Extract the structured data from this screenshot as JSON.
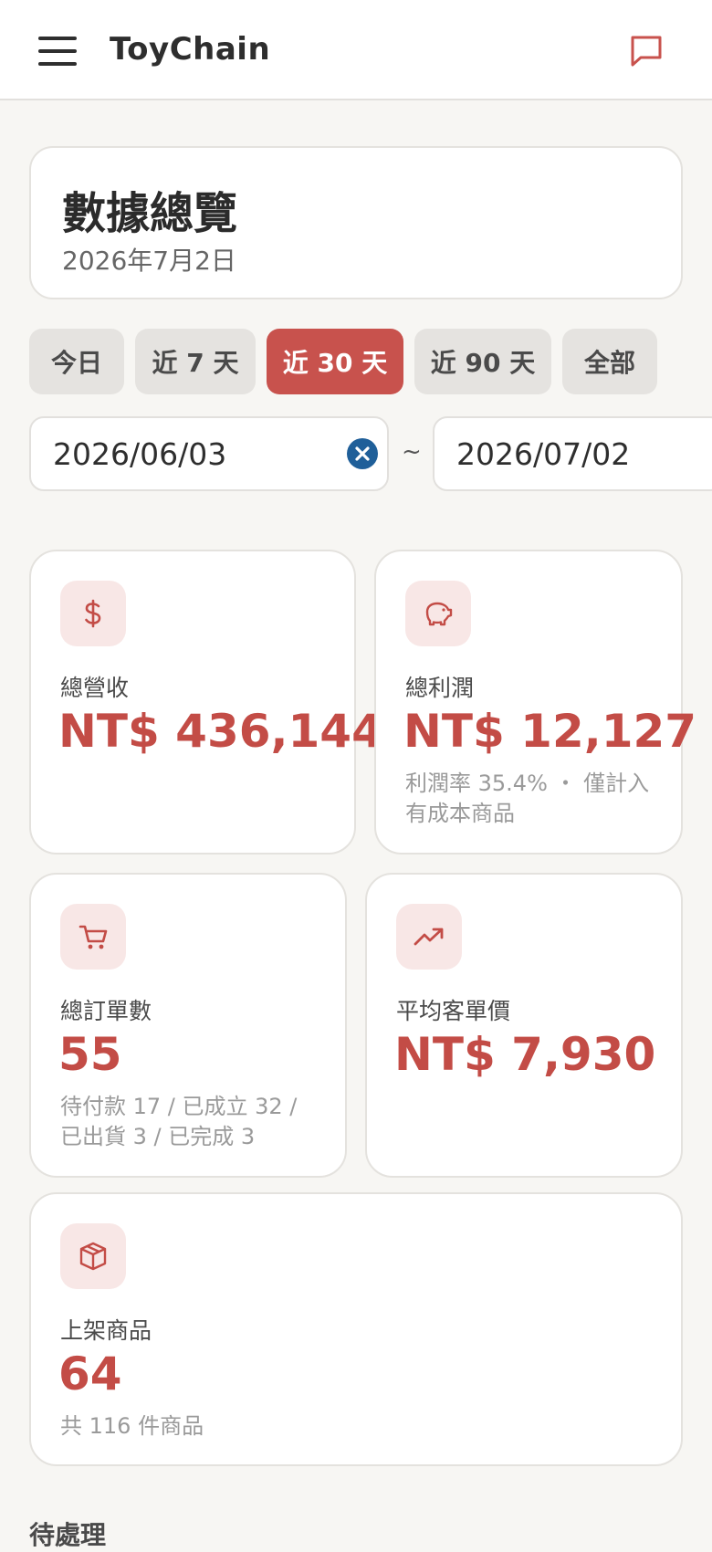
{
  "header": {
    "app_title": "ToyChain"
  },
  "overview": {
    "title": "數據總覽",
    "date": "2026年7月2日"
  },
  "range_buttons": [
    {
      "label": "今日",
      "active": false
    },
    {
      "label": "近 7 天",
      "active": false
    },
    {
      "label": "近 30 天",
      "active": true
    },
    {
      "label": "近 90 天",
      "active": false
    },
    {
      "label": "全部",
      "active": false
    }
  ],
  "date_range": {
    "start": "2026/06/03",
    "separator": "~",
    "end": "2026/07/02"
  },
  "stats": {
    "revenue": {
      "label": "總營收",
      "value": "NT$ 436,144",
      "icon": "dollar-icon"
    },
    "profit": {
      "label": "總利潤",
      "value": "NT$ 12,127",
      "sub": "利潤率 35.4% ・ 僅計入有成本商品",
      "icon": "piggy-bank-icon"
    },
    "orders": {
      "label": "總訂單數",
      "value": "55",
      "sub": "待付款 17 / 已成立 32 / 已出貨 3 / 已完成 3",
      "icon": "cart-icon"
    },
    "avg_order": {
      "label": "平均客單價",
      "value": "NT$ 7,930",
      "icon": "trending-up-icon"
    },
    "products": {
      "label": "上架商品",
      "value": "64",
      "sub": "共 116 件商品",
      "icon": "box-icon"
    }
  },
  "pending": {
    "title": "待處理"
  },
  "colors": {
    "accent": "#c8524d",
    "accent_text": "#c34c46",
    "icon_bg": "#f8e7e6",
    "clear_button": "#1f5f99",
    "page_bg": "#f7f6f3"
  }
}
